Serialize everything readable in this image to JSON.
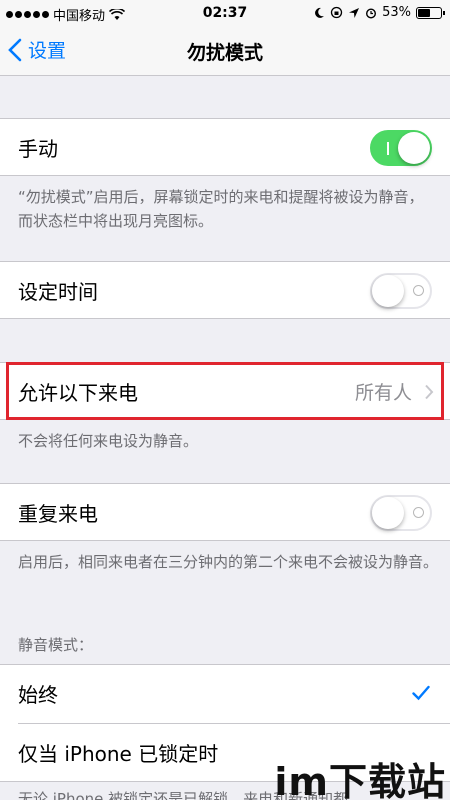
{
  "status_bar": {
    "carrier": "中国移动",
    "time": "02:37",
    "battery": "53%",
    "battery_level": 0.53
  },
  "nav": {
    "back_label": "设置",
    "title": "勿扰模式"
  },
  "manual": {
    "label": "手动",
    "on": true,
    "footer": "“勿扰模式”启用后，屏幕锁定时的来电和提醒将被设为静音，而状态栏中将出现月亮图标。"
  },
  "scheduled": {
    "label": "设定时间",
    "on": false
  },
  "allow_calls": {
    "label": "允许以下来电",
    "value": "所有人",
    "footer": "不会将任何来电设为静音。"
  },
  "repeated_calls": {
    "label": "重复来电",
    "on": false,
    "footer": "启用后，相同来电者在三分钟内的第二个来电不会被设为静音。"
  },
  "silence": {
    "header": "静音模式：",
    "options": [
      "始终",
      "仅当 iPhone 已锁定时"
    ],
    "selected": "始终",
    "footer_partial": "无论 iPhone 被锁定还是已解锁，来电和新通知都"
  },
  "watermark": "im下载站",
  "colors": {
    "accent": "#007aff",
    "switch_on": "#4cd964",
    "highlight": "#e0252e"
  }
}
